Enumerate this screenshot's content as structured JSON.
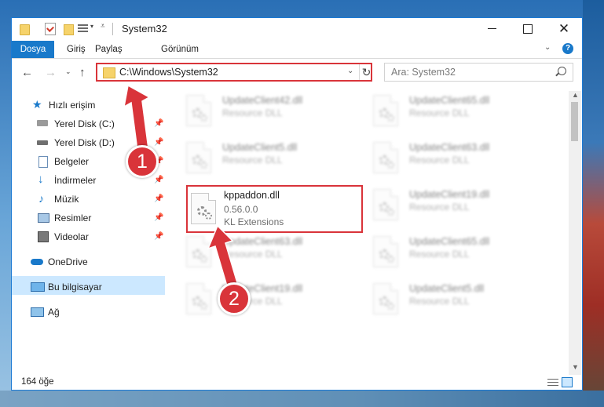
{
  "window": {
    "title": "System32",
    "controls": {
      "minimize": "minimize",
      "maximize": "maximize",
      "close": "✕"
    }
  },
  "ribbon": {
    "tabs": [
      "Dosya",
      "Giriş",
      "Paylaş",
      "Görünüm"
    ],
    "active_tab": "Dosya"
  },
  "nav": {
    "address": "C:\\Windows\\System32",
    "search_placeholder": "Ara: System32"
  },
  "sidebar": {
    "items": [
      {
        "label": "Hızlı erişim",
        "icon": "star-icon",
        "pinned": false
      },
      {
        "label": "Yerel Disk (C:)",
        "icon": "drive-icon",
        "pinned": true
      },
      {
        "label": "Yerel Disk (D:)",
        "icon": "drive-icon",
        "pinned": true
      },
      {
        "label": "Belgeler",
        "icon": "documents-icon",
        "pinned": true
      },
      {
        "label": "İndirmeler",
        "icon": "download-icon",
        "pinned": true
      },
      {
        "label": "Müzik",
        "icon": "music-icon",
        "pinned": true
      },
      {
        "label": "Resimler",
        "icon": "pictures-icon",
        "pinned": true
      },
      {
        "label": "Videolar",
        "icon": "video-icon",
        "pinned": true
      },
      {
        "label": "OneDrive",
        "icon": "cloud-icon",
        "pinned": false
      },
      {
        "label": "Bu bilgisayar",
        "icon": "computer-icon",
        "pinned": false,
        "selected": true
      },
      {
        "label": "Ağ",
        "icon": "network-icon",
        "pinned": false
      }
    ]
  },
  "files": [
    {
      "name": "UpdateClient42.dll",
      "line2": "Resource DLL",
      "line3": ""
    },
    {
      "name": "UpdateClient65.dll",
      "line2": "Resource DLL",
      "line3": ""
    },
    {
      "name": "UpdateClient5.dll",
      "line2": "Resource DLL",
      "line3": ""
    },
    {
      "name": "UpdateClient63.dll",
      "line2": "Resource DLL",
      "line3": ""
    },
    {
      "name": "kppaddon.dll",
      "line2": "0.56.0.0",
      "line3": "KL Extensions",
      "highlighted": true
    },
    {
      "name": "UpdateClient19.dll",
      "line2": "Resource DLL",
      "line3": ""
    },
    {
      "name": "UpdateClient63.dll",
      "line2": "Resource DLL",
      "line3": ""
    },
    {
      "name": "UpdateClient65.dll",
      "line2": "Resource DLL",
      "line3": ""
    },
    {
      "name": "UpdateClient19.dll",
      "line2": "Resource DLL",
      "line3": ""
    },
    {
      "name": "UpdateClient5.dll",
      "line2": "Resource DLL",
      "line3": ""
    }
  ],
  "status": {
    "count": "164 öğe"
  },
  "annotations": {
    "step1": "1",
    "step2": "2",
    "color": "#d9343a"
  }
}
